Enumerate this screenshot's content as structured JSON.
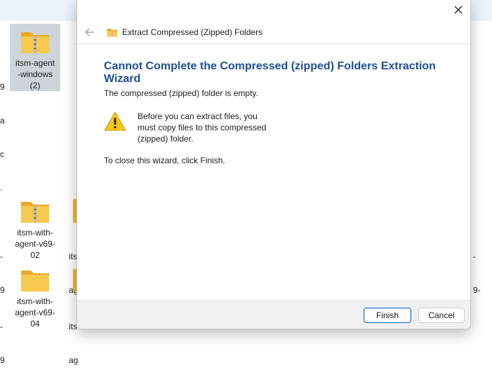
{
  "desktop": {
    "selected_icon_label": [
      "itsm-agent",
      "-windows",
      "(2)"
    ],
    "icons": [
      {
        "label": [
          "itsm-with-",
          "agent-v69-",
          "02"
        ]
      },
      {
        "label": [
          "itsm-with-",
          "agent-v69-",
          "04"
        ]
      }
    ],
    "partial_left": [
      "9",
      "a",
      "c",
      "."
    ],
    "partial_left2": [
      "-",
      "9"
    ],
    "partial_left3": [
      "-",
      "9"
    ],
    "partial_mid1": [
      "its",
      "ag"
    ],
    "partial_mid2": [
      "its",
      "ag"
    ],
    "partial_right": [
      "-",
      "9-"
    ]
  },
  "dialog": {
    "nav_title": "Extract Compressed (Zipped) Folders",
    "headline": "Cannot Complete the Compressed (zipped) Folders Extraction Wizard",
    "message_empty": "The compressed (zipped) folder is empty.",
    "warning_text": "Before you can extract files, you must copy files to this compressed (zipped) folder.",
    "close_instruction": "To close this wizard, click Finish.",
    "buttons": {
      "finish": "Finish",
      "cancel": "Cancel"
    }
  },
  "colors": {
    "headline": "#1e4e95",
    "accent": "#1f6fc5",
    "warning": "#f5c518"
  }
}
